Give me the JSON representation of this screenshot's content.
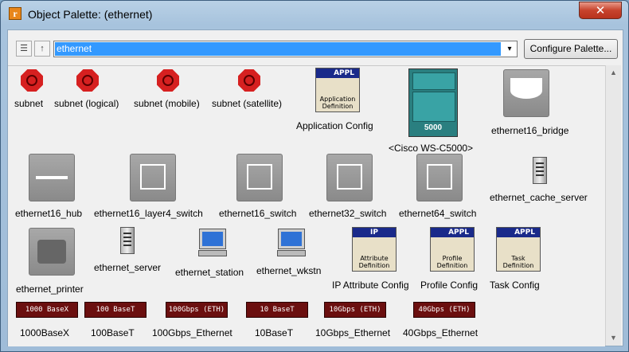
{
  "window": {
    "title": "Object Palette: (ethernet)",
    "close_glyph": "✕"
  },
  "toolbar": {
    "list_view_icon": "☰",
    "up_icon": "↑",
    "palette_select_value": "ethernet",
    "dropdown_arrow": "▾",
    "configure_label": "Configure Palette..."
  },
  "scrollbar": {
    "up_arrow": "▲",
    "down_arrow": "▼"
  },
  "items": {
    "subnet": "subnet",
    "subnet_logical": "subnet (logical)",
    "subnet_mobile": "subnet (mobile)",
    "subnet_satellite": "subnet (satellite)",
    "application_config": "Application Config",
    "cisco_c5000": "<Cisco WS-C5000>",
    "ethernet16_bridge": "ethernet16_bridge",
    "ethernet16_hub": "ethernet16_hub",
    "ethernet16_layer4_switch": "ethernet16_layer4_switch",
    "ethernet16_switch": "ethernet16_switch",
    "ethernet32_switch": "ethernet32_switch",
    "ethernet64_switch": "ethernet64_switch",
    "ethernet_cache_server": "ethernet_cache_server",
    "ethernet_printer": "ethernet_printer",
    "ethernet_server": "ethernet_server",
    "ethernet_station": "ethernet_station",
    "ethernet_wkstn": "ethernet_wkstn",
    "ip_attribute_config": "IP Attribute Config",
    "profile_config": "Profile Config",
    "task_config": "Task Config",
    "link_1000basex": "1000BaseX",
    "link_100baset": "100BaseT",
    "link_100gbps": "100Gbps_Ethernet",
    "link_10baset": "10BaseT",
    "link_10gbps": "10Gbps_Ethernet",
    "link_40gbps": "40Gbps_Ethernet"
  },
  "icon_text": {
    "appl": "APPL",
    "ip": "IP",
    "application_definition": "Application Definition",
    "attribute_definition": "Attribute Definition",
    "profile_definition": "Profile Definition",
    "task_definition": "Task Definition",
    "cisco_model": "5000",
    "link_1000basex": "1000 BaseX",
    "link_100baset": "100 BaseT",
    "link_100gbps": "100Gbps (ETH)",
    "link_10baset": "10 BaseT",
    "link_10gbps": "10Gbps (ETH)",
    "link_40gbps": "40Gbps (ETH)"
  }
}
